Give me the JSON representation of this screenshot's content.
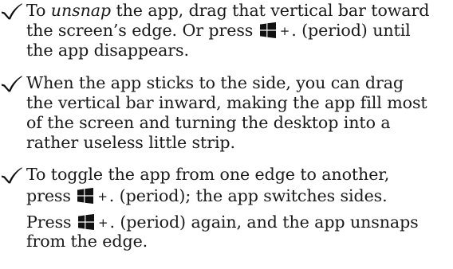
{
  "bullets": [
    {
      "line1_pre": "To ",
      "line1_em": "unsnap",
      "line1_post": " the app, drag that vertical bar toward",
      "line2": "the screen’s edge. Or press",
      "line2_plus": "+",
      "line2_post": ". (period) until",
      "line3": "the app disappears."
    },
    {
      "line1": "When the app sticks to the side, you can drag",
      "line2": "the vertical bar inward, making the app fill most",
      "line3": "of the screen and turning the desktop into a",
      "line4": "rather useless little strip."
    },
    {
      "line1": "To toggle the app from one edge to another,",
      "line2_pre": "press",
      "line2_plus": "+",
      "line2_post": ". (period); the app switches sides."
    }
  ],
  "follow_up": {
    "pre": "Press",
    "plus": "+",
    "post": ". (period) again, and the app unsnaps",
    "line2": "from the edge."
  },
  "icons": {
    "bullet": "check-mark-icon",
    "key": "windows-key-icon"
  },
  "colors": {
    "text": "#1a1a1a",
    "check": "#111111",
    "windows_key": "#111111"
  }
}
